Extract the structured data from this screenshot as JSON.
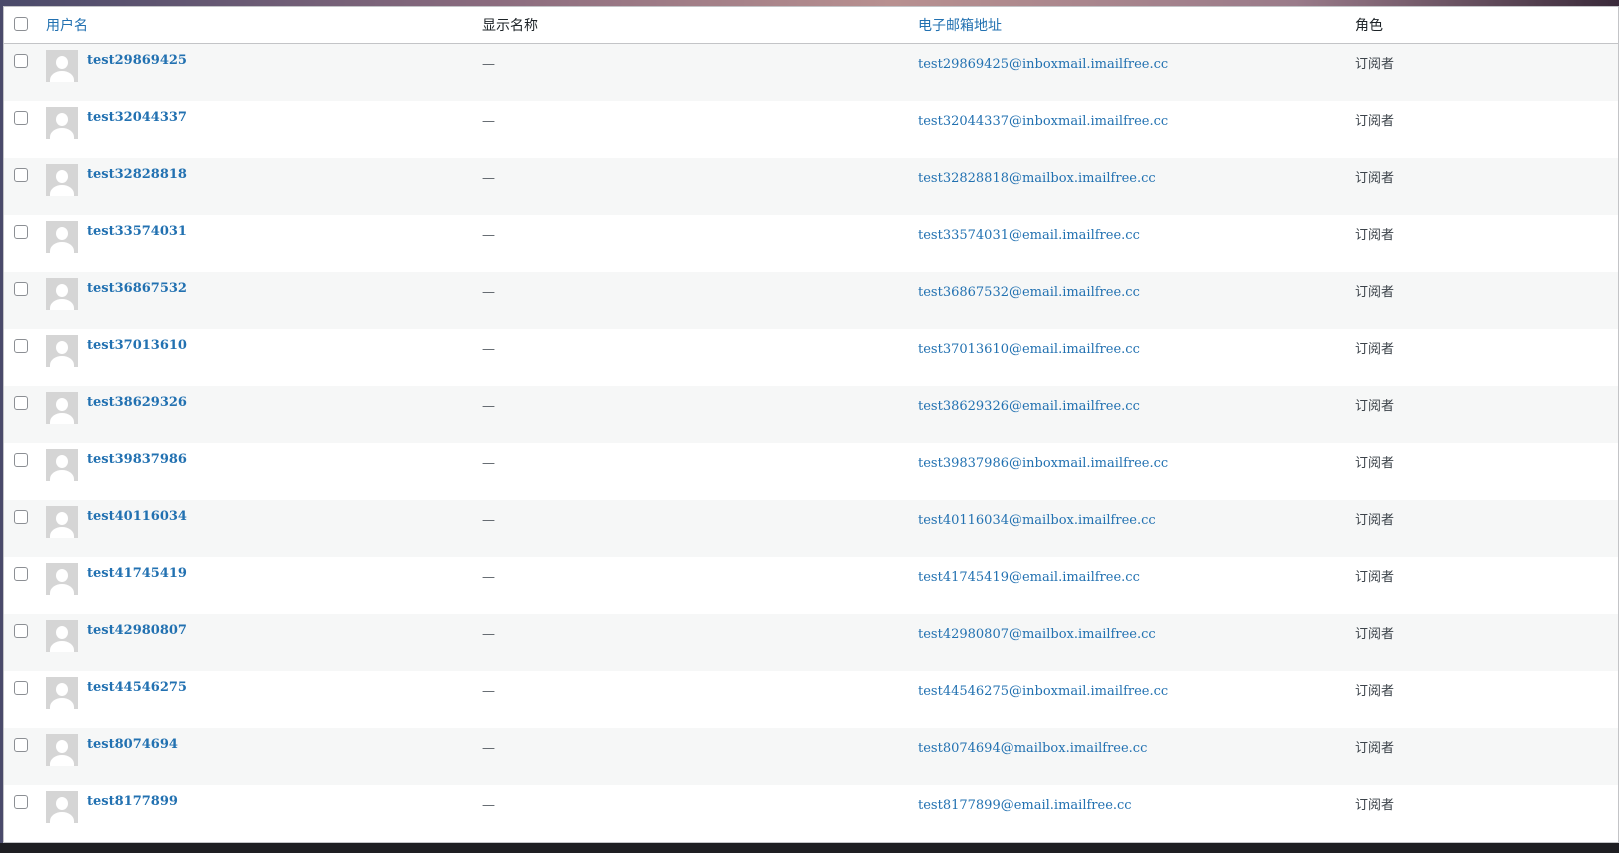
{
  "table": {
    "headers": {
      "username": "用户名",
      "display_name": "显示名称",
      "email": "电子邮箱地址",
      "role": "角色"
    },
    "rows": [
      {
        "username": "test29869425",
        "display_name": "—",
        "email": "test29869425@inboxmail.imailfree.cc",
        "role": "订阅者"
      },
      {
        "username": "test32044337",
        "display_name": "—",
        "email": "test32044337@inboxmail.imailfree.cc",
        "role": "订阅者"
      },
      {
        "username": "test32828818",
        "display_name": "—",
        "email": "test32828818@mailbox.imailfree.cc",
        "role": "订阅者"
      },
      {
        "username": "test33574031",
        "display_name": "—",
        "email": "test33574031@email.imailfree.cc",
        "role": "订阅者"
      },
      {
        "username": "test36867532",
        "display_name": "—",
        "email": "test36867532@email.imailfree.cc",
        "role": "订阅者"
      },
      {
        "username": "test37013610",
        "display_name": "—",
        "email": "test37013610@email.imailfree.cc",
        "role": "订阅者"
      },
      {
        "username": "test38629326",
        "display_name": "—",
        "email": "test38629326@email.imailfree.cc",
        "role": "订阅者"
      },
      {
        "username": "test39837986",
        "display_name": "—",
        "email": "test39837986@inboxmail.imailfree.cc",
        "role": "订阅者"
      },
      {
        "username": "test40116034",
        "display_name": "—",
        "email": "test40116034@mailbox.imailfree.cc",
        "role": "订阅者"
      },
      {
        "username": "test41745419",
        "display_name": "—",
        "email": "test41745419@email.imailfree.cc",
        "role": "订阅者"
      },
      {
        "username": "test42980807",
        "display_name": "—",
        "email": "test42980807@mailbox.imailfree.cc",
        "role": "订阅者"
      },
      {
        "username": "test44546275",
        "display_name": "—",
        "email": "test44546275@inboxmail.imailfree.cc",
        "role": "订阅者"
      },
      {
        "username": "test8074694",
        "display_name": "—",
        "email": "test8074694@mailbox.imailfree.cc",
        "role": "订阅者"
      },
      {
        "username": "test8177899",
        "display_name": "—",
        "email": "test8177899@email.imailfree.cc",
        "role": "订阅者"
      }
    ]
  },
  "colors": {
    "link": "#2271b1",
    "row_alt": "#f6f7f7",
    "border": "#c3c4c7"
  }
}
